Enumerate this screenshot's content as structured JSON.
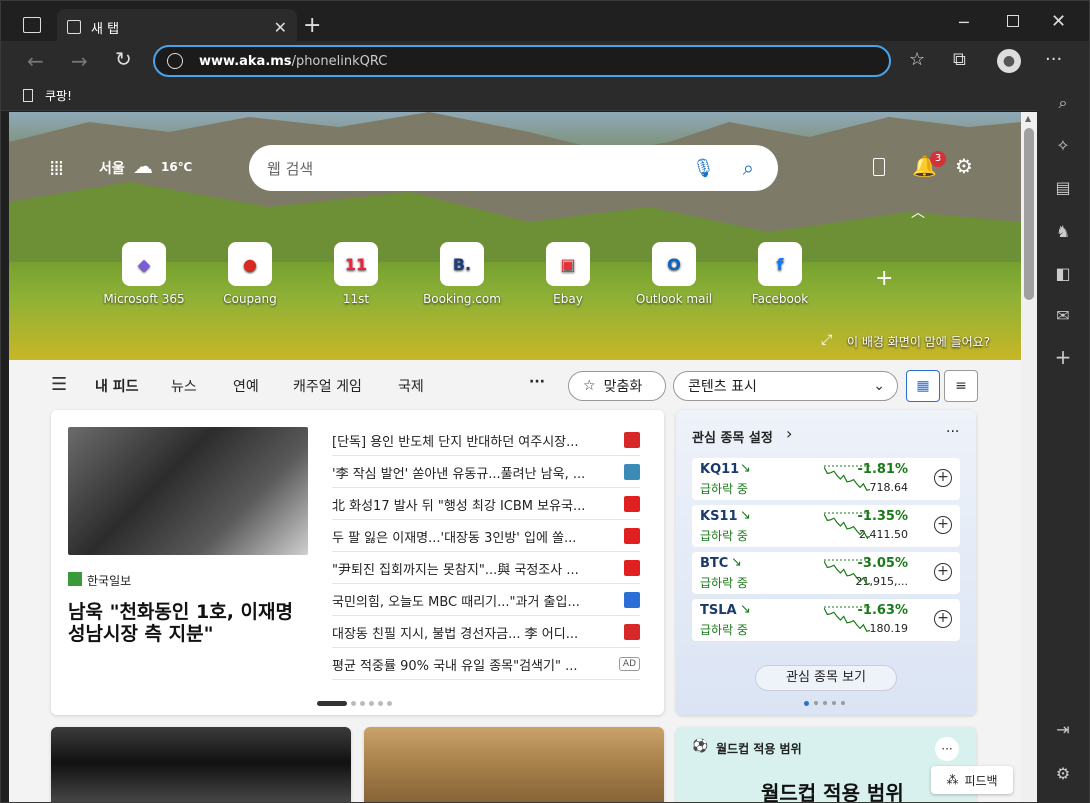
{
  "tab": {
    "title": "새 탭"
  },
  "address": {
    "url_bold": "www.aka.ms",
    "url_rest": "/phonelinkQRC"
  },
  "favorites": [
    {
      "label": "쿠팡!"
    }
  ],
  "hero": {
    "weather_city": "서울",
    "weather_temp": "16℃",
    "search_placeholder": "웹 검색",
    "notification_count": "3",
    "bg_prompt": "이 배경 화면이 맘에 들어요?"
  },
  "quick_links": [
    {
      "label": "Microsoft 365",
      "glyph": "◆",
      "color": "#7b5cd6"
    },
    {
      "label": "Coupang",
      "glyph": "●",
      "color": "#d62b20"
    },
    {
      "label": "11st",
      "glyph": "11",
      "color": "#f0243c"
    },
    {
      "label": "Booking.com",
      "glyph": "B.",
      "color": "#1d3c7a"
    },
    {
      "label": "Ebay",
      "glyph": "▣",
      "color": "#e53238"
    },
    {
      "label": "Outlook mail",
      "glyph": "O",
      "color": "#0a64c4"
    },
    {
      "label": "Facebook",
      "glyph": "f",
      "color": "#1877f2"
    }
  ],
  "feed_nav": {
    "items": [
      "내 피드",
      "뉴스",
      "연예",
      "캐주얼 게임",
      "국제"
    ],
    "more": "···",
    "personalize": "맞춤화",
    "content_display": "콘텐츠 표시"
  },
  "main_story": {
    "source": "한국일보",
    "headline": "남욱 \"천화동인 1호, 이재명 성남시장 측 지분\""
  },
  "headlines": [
    {
      "text": "[단독] 용인 반도체 단지 반대하던 여주시장...",
      "src_color": "#d62828"
    },
    {
      "text": "'李 작심 발언' 쏟아낸 유동규...풀려난 남욱, ...",
      "src_color": "#3a8bb5"
    },
    {
      "text": "北 화성17 발사 뒤 \"행성 최강 ICBM 보유국...",
      "src_color": "#e02020"
    },
    {
      "text": "두 팔 잃은 이재명...'대장동 3인방' 입에 쏠...",
      "src_color": "#e02020"
    },
    {
      "text": "\"尹퇴진 집회까지는 못참지\"...與 국정조사 ...",
      "src_color": "#e02020"
    },
    {
      "text": "국민의힘, 오늘도 MBC 때리기...\"과거 출입...",
      "src_color": "#2b6fd6"
    },
    {
      "text": "대장동 친필 지시, 불법 경선자금... 李 어디...",
      "src_color": "#d62828"
    },
    {
      "text": "평균 적중률 90% 국내 유일 종목\"검색기\" ...",
      "src_color": "#ffffff",
      "ad": "AD"
    }
  ],
  "stocks": {
    "title": "관심 종목 설정",
    "more": "···",
    "items": [
      {
        "name": "KQ11",
        "status": "급하락 중",
        "change": "-1.81%",
        "price": "718.64"
      },
      {
        "name": "KS11",
        "status": "급하락 중",
        "change": "-1.35%",
        "price": "2,411.50"
      },
      {
        "name": "BTC",
        "status": "급하락 중",
        "change": "-3.05%",
        "price": "21,915,..."
      },
      {
        "name": "TSLA",
        "status": "급하락 중",
        "change": "-1.63%",
        "price": "180.19"
      }
    ],
    "view_button": "관심 종목 보기"
  },
  "worldcup": {
    "title": "월드컵 적용 범위",
    "subtitle": "월드컵 적용 범위"
  },
  "feedback": "피드백",
  "colors": {
    "accent": "#4aa3e8",
    "down": "#1a7a1a"
  }
}
